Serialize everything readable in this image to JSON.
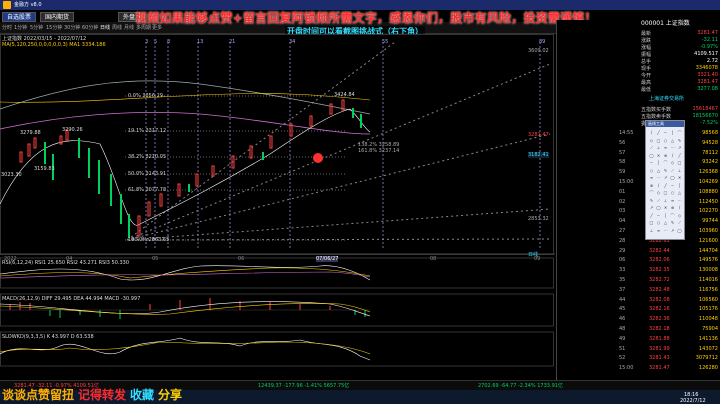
{
  "window": {
    "title": "金融方 v8.0"
  },
  "tabs": [
    "自选股票",
    "国内期货",
    "外盘"
  ],
  "banner": "视频如果能够点赞+留言回复阿锁频所需文字，感恩你们，股市有风险，投资需谨慎！",
  "subbanner": "开盘时间可以看截图挑战式（右下角）",
  "toolbar": {
    "items": [
      "分时",
      "1分钟",
      "5分钟",
      "15分钟",
      "30分钟",
      "60分钟",
      "日线",
      "周线",
      "月线",
      "多周期",
      "更多"
    ],
    "info_line": "上证指数 2022/03/15 - 2022/07/12",
    "ma_line": "MA(5,120,250,0,0,0,0,0,3)  MA1 3334.186"
  },
  "chart": {
    "fib_labels": [
      {
        "pct": "0.0%",
        "val": "3356.29"
      },
      {
        "pct": "19.1%",
        "val": "3317.12"
      },
      {
        "pct": "38.2%",
        "val": "3210.05"
      },
      {
        "pct": "50.0%",
        "val": "3143.91"
      },
      {
        "pct": "61.8%",
        "val": "3077.78"
      },
      {
        "pct": "100.0%",
        "val": "2863.65"
      }
    ],
    "price_tags": [
      "3279.88",
      "3290.26",
      "3159.83",
      "3023.30",
      "3424.84",
      "2863.65"
    ],
    "right_axis": [
      "3609.02",
      "3281.47",
      "3182.41",
      "2853.32"
    ],
    "fib_box": [
      "138.2% 3258.89",
      "161.8% 3237.14"
    ],
    "x_labels": [
      "2022",
      "04",
      "05",
      "06",
      "07/06/27",
      "08",
      "09"
    ],
    "vlines_labels": [
      "3",
      "5",
      "8",
      "13",
      "21",
      "34",
      "55",
      "89"
    ],
    "corner_tag": "日线"
  },
  "indicators": {
    "rsi": "RSI(6,12,24)  RSI1 25.650  RSI2 43.271  RSI3 50.330",
    "macd": "MACD(26,12,9)  DIFF 29.495  DEA 44.994  MACD -30.997",
    "slowkd": "SLOWKD(9,3,3,5)  K 43.997  D 63.538"
  },
  "right_panel": {
    "code": "000001 上证指数",
    "rows": [
      {
        "label": "最新",
        "value": "3281.47",
        "color": "red"
      },
      {
        "label": "涨跌",
        "value": "-32.11",
        "color": "green"
      },
      {
        "label": "涨幅",
        "value": "-0.97%",
        "color": "green"
      },
      {
        "label": "振幅",
        "value": "4109.517",
        "color": "white"
      },
      {
        "label": "总手",
        "value": "2.72",
        "color": "white"
      },
      {
        "label": "现手",
        "value": "3346078",
        "color": "yellow"
      },
      {
        "label": "今开",
        "value": "3321.40",
        "color": "red"
      },
      {
        "label": "最高",
        "value": "3281.47",
        "color": "red"
      },
      {
        "label": "最低",
        "value": "3277.08",
        "color": "green"
      }
    ],
    "exchange_title": "上海证券交易所",
    "sub_rows": [
      {
        "label": "五指数买手数",
        "value": "15618467",
        "color": "red"
      },
      {
        "label": "五指数卖手数",
        "value": "18156670",
        "color": "green"
      },
      {
        "label": "委比",
        "value": "-7.52%",
        "color": "green"
      }
    ],
    "tape": [
      {
        "t": "14:55",
        "p": "3282.80",
        "v": "98568"
      },
      {
        "t": "56",
        "p": "3282.54",
        "v": "94528"
      },
      {
        "t": "57",
        "p": "3282.41",
        "v": "78112"
      },
      {
        "t": "58",
        "p": "3282.37",
        "v": "93242"
      },
      {
        "t": "59",
        "p": "3282.10",
        "v": "126368"
      },
      {
        "t": "15:00",
        "p": "3281.90",
        "v": "104269"
      },
      {
        "t": "01",
        "p": "3281.76",
        "v": "108880"
      },
      {
        "t": "02",
        "p": "3281.65",
        "v": "112450"
      },
      {
        "t": "03",
        "p": "3281.58",
        "v": "102270"
      },
      {
        "t": "04",
        "p": "3281.60",
        "v": "99744"
      },
      {
        "t": "27",
        "p": "3282.01",
        "v": "103960"
      },
      {
        "t": "28",
        "p": "3282.61",
        "v": "121600"
      },
      {
        "t": "29",
        "p": "3282.44",
        "v": "144704"
      },
      {
        "t": "06",
        "p": "3282.06",
        "v": "149576"
      },
      {
        "t": "33",
        "p": "3282.35",
        "v": "130008"
      },
      {
        "t": "35",
        "p": "3282.72",
        "v": "114016"
      },
      {
        "t": "37",
        "p": "3282.48",
        "v": "116756"
      },
      {
        "t": "44",
        "p": "3282.08",
        "v": "106560"
      },
      {
        "t": "45",
        "p": "3282.16",
        "v": "105176"
      },
      {
        "t": "46",
        "p": "3282.36",
        "v": "110048"
      },
      {
        "t": "48",
        "p": "3282.18",
        "v": "75904"
      },
      {
        "t": "49",
        "p": "3281.88",
        "v": "141136"
      },
      {
        "t": "51",
        "p": "3281.99",
        "v": "143072"
      },
      {
        "t": "52",
        "p": "3281.43",
        "v": "3079712"
      },
      {
        "t": "15:00",
        "p": "3281.47",
        "v": "126280"
      }
    ],
    "tools_title": "画线工具"
  },
  "status": {
    "left": "3281.47  -32.11  -0.97%  4109.51亿",
    "mid": "12439.37  -177.96  -1.41%  5657.75亿",
    "right": "2702.69  -64.77  -2.34%  1733.91亿"
  },
  "bottom_banner": [
    "谈谈点赞留扭",
    "记得转发",
    "收藏",
    "分享"
  ],
  "clock": {
    "time": "18:16",
    "date": "2022/7/12"
  }
}
